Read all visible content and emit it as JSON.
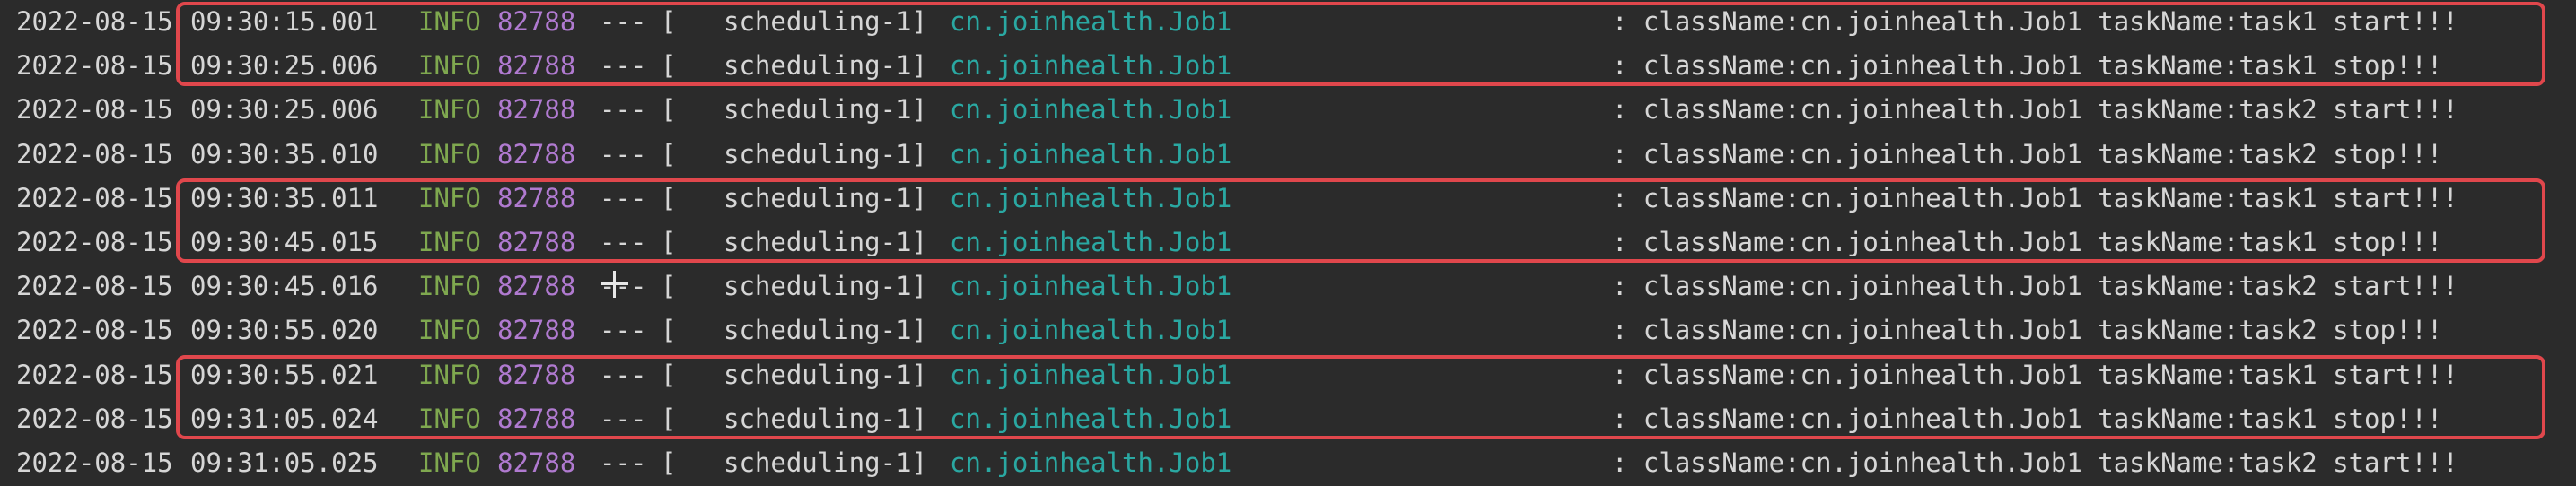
{
  "colors": {
    "background": "#2b2b2b",
    "text": "#d6d6d6",
    "info_level": "#7fa84f",
    "pid": "#b07ad0",
    "logger": "#2aa8a2",
    "highlight_box": "#e0474c"
  },
  "log_lines": [
    {
      "date": "2022-08-15",
      "time": "09:30:15.001",
      "level": "INFO",
      "pid": "82788",
      "sep": "---",
      "bracket": "[",
      "thread": "scheduling-1]",
      "logger": "cn.joinhealth.Job1",
      "message": ": className:cn.joinhealth.Job1 taskName:task1 start!!!"
    },
    {
      "date": "2022-08-15",
      "time": "09:30:25.006",
      "level": "INFO",
      "pid": "82788",
      "sep": "---",
      "bracket": "[",
      "thread": "scheduling-1]",
      "logger": "cn.joinhealth.Job1",
      "message": ": className:cn.joinhealth.Job1 taskName:task1 stop!!!"
    },
    {
      "date": "2022-08-15",
      "time": "09:30:25.006",
      "level": "INFO",
      "pid": "82788",
      "sep": "---",
      "bracket": "[",
      "thread": "scheduling-1]",
      "logger": "cn.joinhealth.Job1",
      "message": ": className:cn.joinhealth.Job1 taskName:task2 start!!!"
    },
    {
      "date": "2022-08-15",
      "time": "09:30:35.010",
      "level": "INFO",
      "pid": "82788",
      "sep": "---",
      "bracket": "[",
      "thread": "scheduling-1]",
      "logger": "cn.joinhealth.Job1",
      "message": ": className:cn.joinhealth.Job1 taskName:task2 stop!!!"
    },
    {
      "date": "2022-08-15",
      "time": "09:30:35.011",
      "level": "INFO",
      "pid": "82788",
      "sep": "---",
      "bracket": "[",
      "thread": "scheduling-1]",
      "logger": "cn.joinhealth.Job1",
      "message": ": className:cn.joinhealth.Job1 taskName:task1 start!!!"
    },
    {
      "date": "2022-08-15",
      "time": "09:30:45.015",
      "level": "INFO",
      "pid": "82788",
      "sep": "---",
      "bracket": "[",
      "thread": "scheduling-1]",
      "logger": "cn.joinhealth.Job1",
      "message": ": className:cn.joinhealth.Job1 taskName:task1 stop!!!"
    },
    {
      "date": "2022-08-15",
      "time": "09:30:45.016",
      "level": "INFO",
      "pid": "82788",
      "sep": "---",
      "bracket": "[",
      "thread": "scheduling-1]",
      "logger": "cn.joinhealth.Job1",
      "message": ": className:cn.joinhealth.Job1 taskName:task2 start!!!"
    },
    {
      "date": "2022-08-15",
      "time": "09:30:55.020",
      "level": "INFO",
      "pid": "82788",
      "sep": "---",
      "bracket": "[",
      "thread": "scheduling-1]",
      "logger": "cn.joinhealth.Job1",
      "message": ": className:cn.joinhealth.Job1 taskName:task2 stop!!!"
    },
    {
      "date": "2022-08-15",
      "time": "09:30:55.021",
      "level": "INFO",
      "pid": "82788",
      "sep": "---",
      "bracket": "[",
      "thread": "scheduling-1]",
      "logger": "cn.joinhealth.Job1",
      "message": ": className:cn.joinhealth.Job1 taskName:task1 start!!!"
    },
    {
      "date": "2022-08-15",
      "time": "09:31:05.024",
      "level": "INFO",
      "pid": "82788",
      "sep": "---",
      "bracket": "[",
      "thread": "scheduling-1]",
      "logger": "cn.joinhealth.Job1",
      "message": ": className:cn.joinhealth.Job1 taskName:task1 stop!!!"
    },
    {
      "date": "2022-08-15",
      "time": "09:31:05.025",
      "level": "INFO",
      "pid": "82788",
      "sep": "---",
      "bracket": "[",
      "thread": "scheduling-1]",
      "logger": "cn.joinhealth.Job1",
      "message": ": className:cn.joinhealth.Job1 taskName:task2 start!!!"
    }
  ],
  "highlight_boxes": [
    {
      "covers_lines": [
        0,
        1
      ]
    },
    {
      "covers_lines": [
        4,
        5
      ]
    },
    {
      "covers_lines": [
        8,
        9
      ]
    }
  ],
  "cursor": {
    "icon": "text-cursor-crosshair-icon"
  }
}
